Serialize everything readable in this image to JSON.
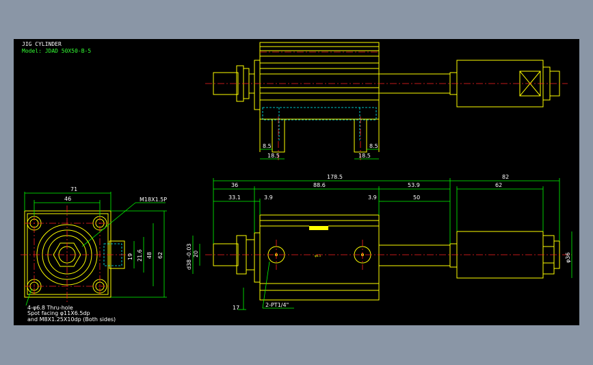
{
  "drawing": {
    "title": "JIG CYLINDER",
    "model": "Model: JDAD 50X50-B-5",
    "colors": {
      "background": "#000000",
      "frame": "#8a96a6",
      "outline": "#ffff00",
      "dimension": "#00ff00",
      "centerline": "#ff2020",
      "hidden": "#00ffff",
      "text": "#ffffff"
    }
  },
  "top_view": {
    "dims": {
      "d1": "8.5",
      "d2": "8.5",
      "d3": "18.5",
      "d4": "18.5"
    }
  },
  "front_view": {
    "dims": {
      "overall_length": "178.5",
      "rod_ext": "82",
      "d36": "36",
      "d886": "88.6",
      "d539": "53.9",
      "d62": "62",
      "d331": "33.1",
      "d39a": "3.9",
      "d39b": "3.9",
      "d50": "50",
      "d20": "20",
      "bore": "d38 -0.03",
      "d17": "17",
      "rod_dia": "φ36"
    },
    "port_label": "2-PT1/4\"",
    "center_label": "φ6.5"
  },
  "side_view": {
    "dims": {
      "d71": "71",
      "d46": "46",
      "d19": "19",
      "d216": "21.6",
      "d48": "48",
      "d62": "62"
    },
    "thread_label": "M18X1.5P",
    "notes": [
      "4-φ6.8   Thru-hole",
      "Spot facing φ11X6.5dp",
      "and M8X1.25X10dp (Both sides)"
    ]
  }
}
